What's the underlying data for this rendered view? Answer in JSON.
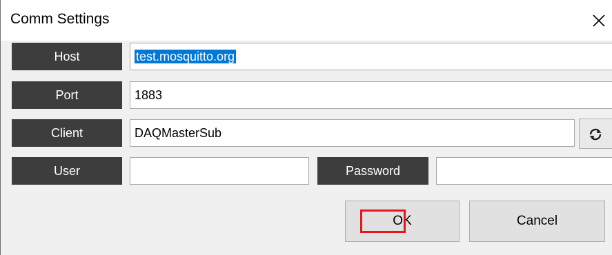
{
  "window": {
    "title": "Comm Settings",
    "close_icon": "close-icon"
  },
  "form": {
    "host": {
      "label": "Host",
      "value": "test.mosquitto.org"
    },
    "port": {
      "label": "Port",
      "value": "1883"
    },
    "client": {
      "label": "Client",
      "value": "DAQMasterSub",
      "refresh_icon": "refresh-icon"
    },
    "user": {
      "label": "User",
      "value": ""
    },
    "password": {
      "label": "Password",
      "value": ""
    }
  },
  "buttons": {
    "ok_label": "OK",
    "cancel_label": "Cancel"
  },
  "colors": {
    "label_bg": "#3d3d3d",
    "selection": "#0078d7",
    "highlight_box": "#e5161e"
  }
}
